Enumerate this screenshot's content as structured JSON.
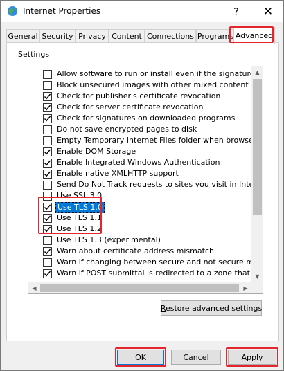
{
  "window": {
    "title": "Internet Properties",
    "help_glyph": "?",
    "close_glyph": "✕"
  },
  "tabs": [
    {
      "label": "General"
    },
    {
      "label": "Security"
    },
    {
      "label": "Privacy"
    },
    {
      "label": "Content"
    },
    {
      "label": "Connections"
    },
    {
      "label": "Programs"
    },
    {
      "label": "Advanced"
    }
  ],
  "active_tab": "Advanced",
  "settings": {
    "group_label": "Settings",
    "items": [
      {
        "label": "Allow software to run or install even if the signature is inva",
        "checked": false
      },
      {
        "label": "Block unsecured images with other mixed content",
        "checked": false
      },
      {
        "label": "Check for publisher's certificate revocation",
        "checked": true
      },
      {
        "label": "Check for server certificate revocation",
        "checked": true
      },
      {
        "label": "Check for signatures on downloaded programs",
        "checked": true
      },
      {
        "label": "Do not save encrypted pages to disk",
        "checked": false
      },
      {
        "label": "Empty Temporary Internet Files folder when browser is clo",
        "checked": false
      },
      {
        "label": "Enable DOM Storage",
        "checked": true
      },
      {
        "label": "Enable Integrated Windows Authentication",
        "checked": true
      },
      {
        "label": "Enable native XMLHTTP support",
        "checked": true
      },
      {
        "label": "Send Do Not Track requests to sites you visit in Internet E",
        "checked": false
      },
      {
        "label": "Use SSL 3.0",
        "checked": false
      },
      {
        "label": "Use TLS 1.0",
        "checked": true
      },
      {
        "label": "Use TLS 1.1",
        "checked": true
      },
      {
        "label": "Use TLS 1.2",
        "checked": true
      },
      {
        "label": "Use TLS 1.3 (experimental)",
        "checked": false
      },
      {
        "label": "Warn about certificate address mismatch",
        "checked": true
      },
      {
        "label": "Warn if changing between secure and not secure mode",
        "checked": false
      },
      {
        "label": "Warn if POST submittal is redirected to a zone that does n",
        "checked": true
      }
    ],
    "selected_index": 12
  },
  "buttons": {
    "restore": "Restore advanced settings",
    "ok": "OK",
    "cancel": "Cancel",
    "apply": "Apply"
  },
  "colors": {
    "highlight_box": "#e3252d",
    "selection": "#0078d7"
  }
}
